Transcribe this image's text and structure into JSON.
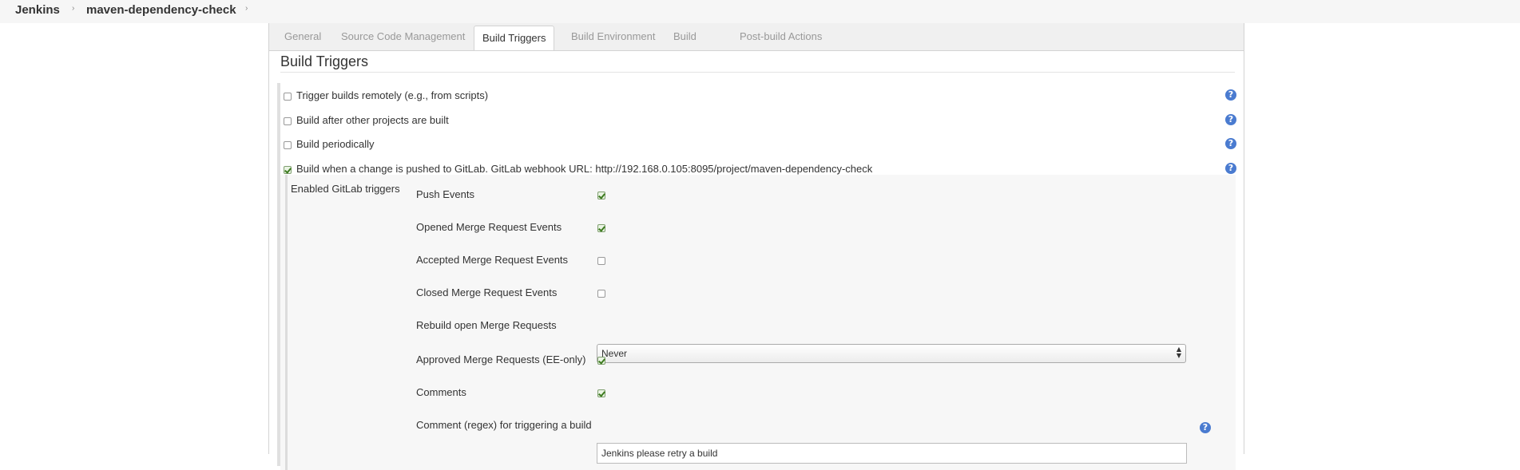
{
  "breadcrumb": {
    "items": [
      "Jenkins",
      "maven-dependency-check"
    ],
    "separator": "›"
  },
  "tabs": [
    {
      "label": "General",
      "active": false
    },
    {
      "label": "Source Code Management",
      "active": false
    },
    {
      "label": "Build Triggers",
      "active": true
    },
    {
      "label": "Build Environment",
      "active": false
    },
    {
      "label": "Build",
      "active": false
    },
    {
      "label": "Post-build Actions",
      "active": false
    }
  ],
  "section": {
    "title": "Build Triggers"
  },
  "triggers": [
    {
      "label": "Trigger builds remotely (e.g., from scripts)",
      "checked": false
    },
    {
      "label": "Build after other projects are built",
      "checked": false
    },
    {
      "label": "Build periodically",
      "checked": false
    },
    {
      "label": "Build when a change is pushed to GitLab. GitLab webhook URL: http://192.168.0.105:8095/project/maven-dependency-check",
      "checked": true
    }
  ],
  "help_glyph": "?",
  "gitlab": {
    "group_label": "Enabled GitLab triggers",
    "options": [
      {
        "label": "Push Events",
        "checked": true
      },
      {
        "label": "Opened Merge Request Events",
        "checked": true
      },
      {
        "label": "Accepted Merge Request Events",
        "checked": false
      },
      {
        "label": "Closed Merge Request Events",
        "checked": false
      }
    ],
    "rebuild": {
      "label": "Rebuild open Merge Requests",
      "selected": "Never"
    },
    "options2": [
      {
        "label": "Approved Merge Requests (EE-only)",
        "checked": true
      },
      {
        "label": "Comments",
        "checked": true
      }
    ],
    "comment_regex": {
      "label": "Comment (regex) for triggering a build",
      "value": "Jenkins please retry a build"
    }
  },
  "colors": {
    "help_icon": "#4a7bd0",
    "check": "#3c7a1e"
  }
}
